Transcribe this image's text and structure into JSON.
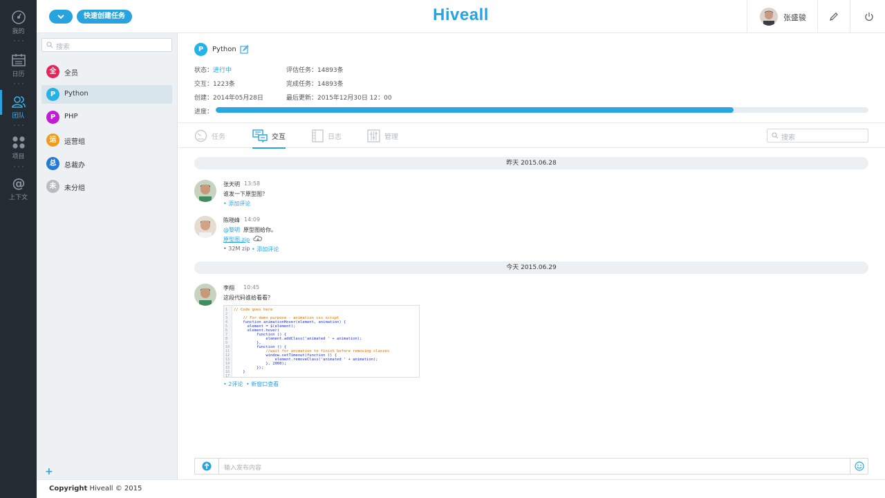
{
  "app": {
    "logo": "Hiveall"
  },
  "rail": {
    "items": [
      {
        "label": "我的",
        "icon": "dashboard-icon"
      },
      {
        "label": "日历",
        "icon": "calendar-icon"
      },
      {
        "label": "团队",
        "icon": "team-icon",
        "active": true
      },
      {
        "label": "项目",
        "icon": "projects-icon"
      },
      {
        "label": "上下文",
        "icon": "at-icon"
      }
    ]
  },
  "header": {
    "quick_create": "快速创建任务",
    "user_name": "张盛骏"
  },
  "groups": {
    "search_placeholder": "搜索",
    "items": [
      {
        "initial": "全",
        "label": "全员",
        "color": "#e6245a"
      },
      {
        "initial": "P",
        "label": "Python",
        "color": "#23b3e8",
        "active": true
      },
      {
        "initial": "P",
        "label": "PHP",
        "color": "#c21bd6"
      },
      {
        "initial": "运",
        "label": "运营组",
        "color": "#f39a1d"
      },
      {
        "initial": "总",
        "label": "总裁办",
        "color": "#2279d6"
      },
      {
        "initial": "未",
        "label": "未分组",
        "color": "#b7bcc1"
      }
    ],
    "add": "+"
  },
  "project": {
    "badge": "P",
    "name": "Python",
    "status_label": "状态：",
    "status_value": "进行中",
    "interact_label": "交互：",
    "interact_value": "1223条",
    "created_label": "创建：",
    "created_value": "2014年05月28日",
    "eval_label": "评估任务：",
    "eval_value": "14893条",
    "done_label": "完成任务：",
    "done_value": "14893条",
    "updated_label": "最后更新：",
    "updated_value": "2015年12月30日  12：00",
    "progress_label": "进度：",
    "progress_fraction": 0.793
  },
  "tabs": [
    {
      "label": "任务",
      "icon": "task-gauge-icon"
    },
    {
      "label": "交互",
      "icon": "chat-icon",
      "active": true
    },
    {
      "label": "日志",
      "icon": "log-film-icon"
    },
    {
      "label": "管理",
      "icon": "sliders-icon"
    }
  ],
  "tab_search_placeholder": "搜索",
  "feed": {
    "day1": "昨天  2015.06.28",
    "day2": "今天  2015.06.29",
    "msg1": {
      "author": "张天明",
      "time": "13:58",
      "text": "谁发一下原型图？",
      "action": "• 添加评论"
    },
    "msg2": {
      "author": "陈晓峰",
      "time": "14:09",
      "mention": "@黎明",
      "text": "原型图给你。",
      "file": "原型图.zip",
      "meta": "• 32M zip",
      "action": "• 添加评论"
    },
    "msg3": {
      "author": "李翔",
      "time": "10:45",
      "text": "这段代码谁给看看？",
      "comments": "• 2评论",
      "open": "• 新窗口查看"
    }
  },
  "code": {
    "lines": [
      "// Code goes here",
      "",
      "    // For demo purpose - animation css script",
      "    function animationHover(element, animation) {",
      "      element = $(element);",
      "      element.hover(",
      "          function () {",
      "              element.addClass('animated ' + animation);",
      "          },",
      "          function () {",
      "              //wait for animation to finish before removing classes",
      "              window.setTimeout(function () {",
      "                  element.removeClass('animated ' + animation);",
      "              }, 2000);",
      "          });",
      "    }",
      ""
    ],
    "numbers": [
      "1",
      "2",
      "3",
      "4",
      "5",
      "6",
      "7",
      "8",
      "9",
      "10",
      "11",
      "12",
      "13",
      "14",
      "15",
      "16",
      "17"
    ]
  },
  "composer": {
    "placeholder": "输入发布内容"
  },
  "footer": {
    "copyright_bold": "Copyright",
    "copyright_rest": " Hiveall © 2015"
  }
}
